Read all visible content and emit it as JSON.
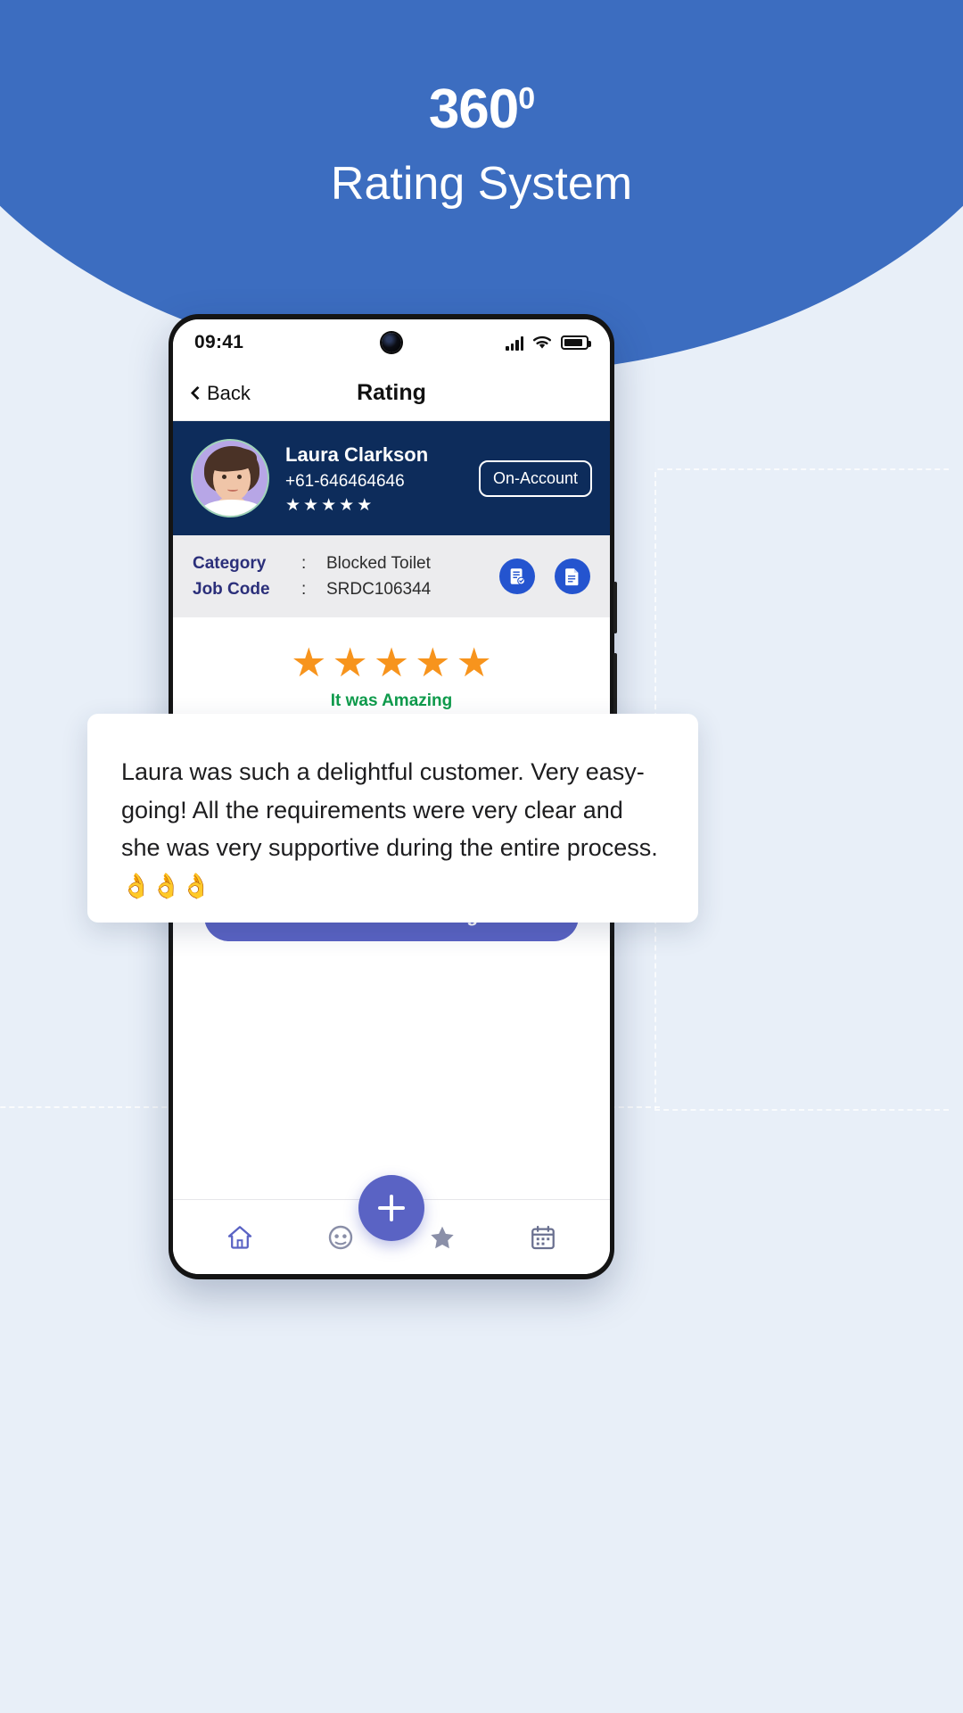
{
  "hero": {
    "title_number": "360",
    "title_degree": "0",
    "subtitle": "Rating System"
  },
  "phone": {
    "status_bar": {
      "time": "09:41",
      "camera_icon": "camera-dot-icon",
      "signal_icon": "cellular-signal-icon",
      "wifi_icon": "wifi-icon",
      "battery_icon": "battery-icon"
    },
    "nav": {
      "back_label": "Back",
      "back_icon": "chevron-left-icon",
      "title": "Rating"
    },
    "profile": {
      "name": "Laura Clarkson",
      "phone": "+61-646464646",
      "stars": "★★★★★",
      "account_badge": "On-Account",
      "avatar_icon": "avatar"
    },
    "job": {
      "rows": [
        {
          "label": "Category",
          "colon": ":",
          "value": "Blocked Toilet"
        },
        {
          "label": "Job Code",
          "colon": ":",
          "value": "SRDC106344"
        }
      ],
      "icons": [
        "invoice-document-icon",
        "quote-document-icon"
      ]
    },
    "rating": {
      "stars": "★★★★★",
      "star_count": 5,
      "caption": "It was Amazing",
      "submit_label": "Submit Your Rating"
    },
    "tabbar": {
      "items": [
        {
          "name": "home",
          "icon": "home-icon"
        },
        {
          "name": "customers",
          "icon": "customer-face-icon"
        },
        {
          "name": "add",
          "icon": "plus-icon"
        },
        {
          "name": "favourites",
          "icon": "star-icon"
        },
        {
          "name": "calendar",
          "icon": "calendar-icon"
        }
      ]
    }
  },
  "overlay": {
    "review_text": "Laura was such a delightful customer. Very easy-going! All the requirements were very clear and she was very supportive during the entire process. 👌👌👌"
  },
  "colors": {
    "hero_blue": "#3c6dc0",
    "page_bg": "#e8eff8",
    "profile_navy": "#0d2c5b",
    "accent_purple": "#5a63c4",
    "star_orange": "#f7941d",
    "caption_green": "#0f9b4c",
    "icon_blue": "#2454cf",
    "label_indigo": "#2b2f7a",
    "job_strip_grey": "#ececee"
  }
}
